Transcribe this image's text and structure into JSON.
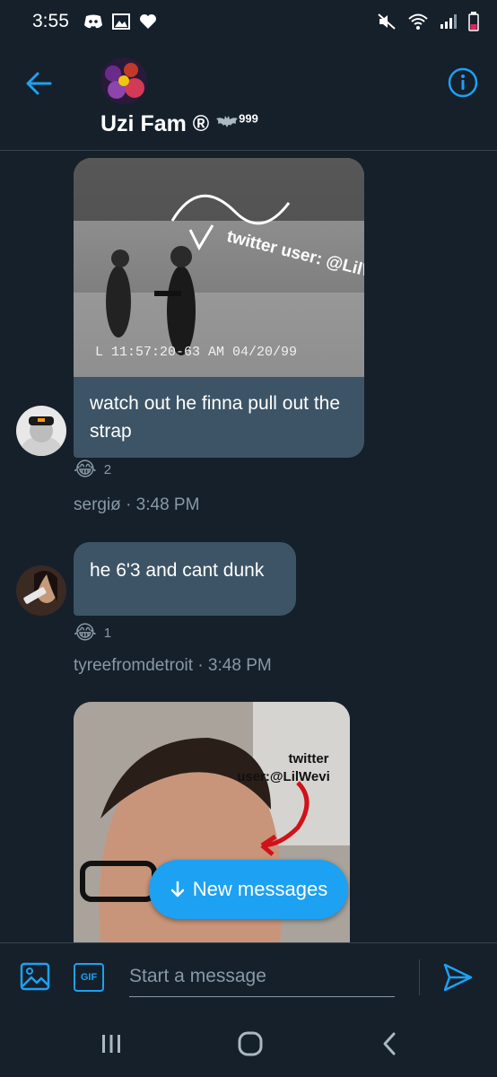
{
  "status_bar": {
    "time": "3:55",
    "left_icons": [
      "discord-icon",
      "gallery-icon",
      "heart-icon"
    ],
    "right_icons": [
      "mute-icon",
      "wifi-icon",
      "signal-icon",
      "battery-icon"
    ]
  },
  "header": {
    "title": "Uzi Fam ®",
    "title_suffix": "999",
    "back_icon": "arrow-left-icon",
    "info_icon": "info-icon"
  },
  "messages": [
    {
      "sender": "sergiø",
      "image_caption": "twitter user: @LilWevi",
      "image_timestamp": "L 11:57:20-63 AM  04/20/99",
      "text": "watch out he finna pull out the strap",
      "reaction_emoji": "😂",
      "reaction_count": "2",
      "meta": "sergiø · 3:48 PM"
    },
    {
      "sender": "tyreefromdetroit",
      "text": "he 6'3 and cant dunk",
      "reaction_emoji": "😂",
      "reaction_count": "1",
      "meta": "tyreefromdetroit · 3:48 PM"
    },
    {
      "sender": "unknown",
      "image_caption_line1": "twitter",
      "image_caption_line2": "user:@LilWevi"
    }
  ],
  "new_messages_button": "New messages",
  "composer": {
    "placeholder": "Start a message",
    "gif_label": "GIF"
  },
  "colors": {
    "background": "#15202b",
    "accent": "#1da1f2",
    "bubble": "#3d5466",
    "muted_text": "#8899a6"
  }
}
